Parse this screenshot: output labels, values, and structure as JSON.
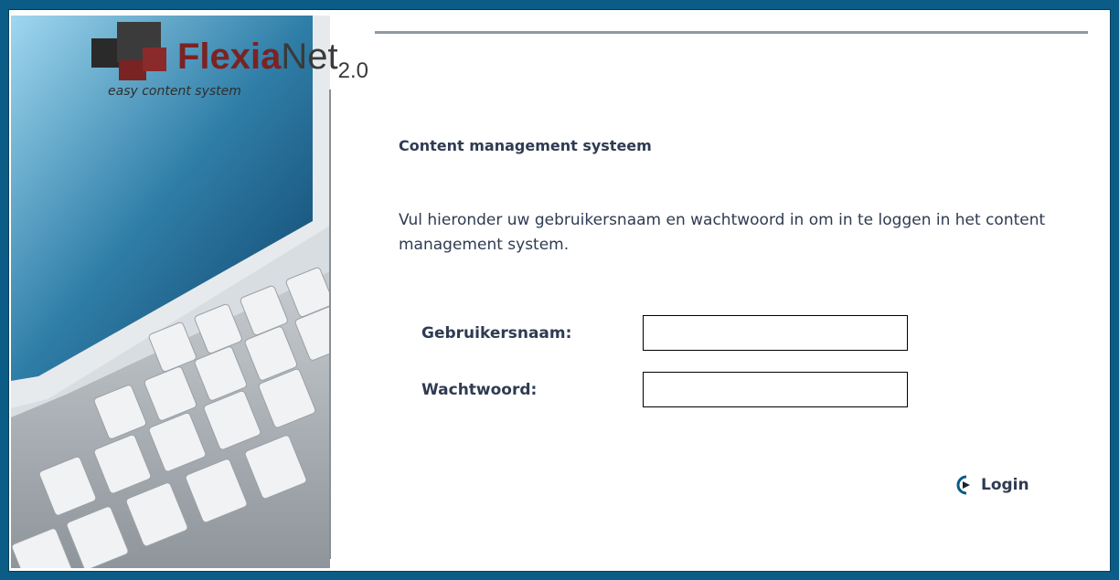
{
  "logo": {
    "brand_part1": "Flexia",
    "brand_part2": "Net",
    "version": "2.0",
    "tagline": "easy content system"
  },
  "page": {
    "title": "Content management systeem",
    "intro": "Vul hieronder uw gebruikersnaam en wachtwoord in om in te loggen in het content management system."
  },
  "form": {
    "username_label": "Gebruikersnaam:",
    "username_value": "",
    "password_label": "Wachtwoord:",
    "password_value": "",
    "login_label": "Login",
    "login_icon": "play-arrow-icon"
  },
  "colors": {
    "border": "#0b5c86",
    "brand_red": "#7b2323",
    "text": "#2f3b52"
  }
}
